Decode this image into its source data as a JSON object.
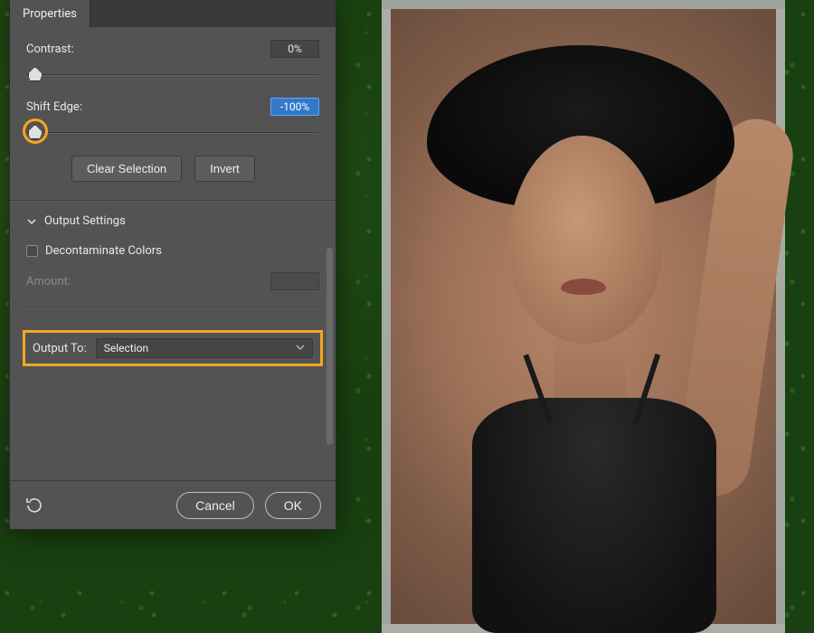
{
  "panel": {
    "tab_label": "Properties",
    "contrast": {
      "label": "Contrast:",
      "value": "0%",
      "thumb_pct": 3
    },
    "shift_edge": {
      "label": "Shift Edge:",
      "value": "-100%",
      "thumb_pct": 3,
      "highlighted": true
    },
    "buttons": {
      "clear": "Clear Selection",
      "invert": "Invert"
    },
    "output_section": {
      "title": "Output Settings",
      "decontaminate_label": "Decontaminate Colors",
      "decontaminate_checked": false,
      "amount_label": "Amount:",
      "amount_value": "",
      "output_to_label": "Output To:",
      "output_to_value": "Selection"
    },
    "footer": {
      "cancel": "Cancel",
      "ok": "OK"
    }
  },
  "colors": {
    "accent_highlight": "#f5a623",
    "selection_blue": "#3478c8"
  }
}
